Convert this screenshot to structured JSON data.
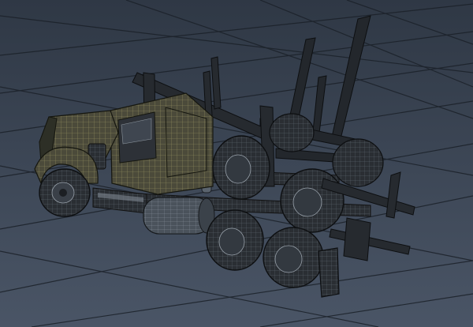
{
  "viewport": {
    "name": "3d-viewport",
    "background_top": "#2f3845",
    "background_bottom": "#4a5566",
    "grid_color": "#1b2129",
    "model": "log-truck-wireframe"
  },
  "colors": {
    "cab_shell": "#4b4a3a",
    "cab_wire": "#a9a26a",
    "frame": "#2a2e33",
    "frame_wire": "#7b8490",
    "tire": "#2b3036",
    "tire_wire": "#8a939c",
    "chrome": "#7e8791"
  }
}
